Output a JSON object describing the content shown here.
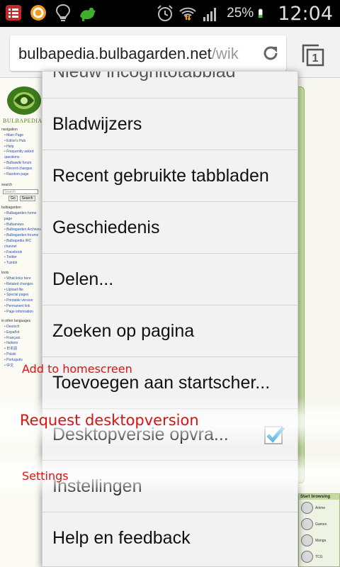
{
  "status_bar": {
    "battery_percent": "25%",
    "time": "12:04",
    "notification_icons": [
      "tasks-icon",
      "orange-ring-icon",
      "lightbulb-icon",
      "green-dino-icon"
    ],
    "system_icons": [
      "alarm-icon",
      "wifi-icon",
      "signal-icon",
      "battery-icon"
    ]
  },
  "toolbar": {
    "url_domain": "bulbapedia.bulbagarden.net",
    "url_path": "/wik",
    "reload_icon": "reload-icon",
    "tab_count": "1"
  },
  "page": {
    "logo_text": "BULBAPEDIA",
    "sections": {
      "navigation": {
        "title": "navigation",
        "items": [
          "Main Page",
          "Editor's Hub",
          "Help",
          "Frequently asked questions",
          "Bulbawiki forum",
          "Recent changes",
          "Random page"
        ]
      },
      "search": {
        "title": "search",
        "placeholder": "Search",
        "go_label": "Go",
        "search_label": "Search"
      },
      "bulbagarden": {
        "title": "bulbagarden",
        "items": [
          "Bulbagarden home page",
          "Bulbanews",
          "Bulbagarden Archives",
          "Bulbagarden forums",
          "Bulbapedia IRC channel",
          "Facebook",
          "Twitter",
          "Tumblr"
        ]
      },
      "tools": {
        "title": "tools",
        "items": [
          "What links here",
          "Related changes",
          "Upload file",
          "Special pages",
          "Printable version",
          "Permanent link",
          "Page information"
        ]
      },
      "languages": {
        "title": "in other languages",
        "items": [
          "Deutsch",
          "Español",
          "Français",
          "Italiano",
          "日本語",
          "Polski",
          "Português",
          "中文"
        ]
      }
    },
    "start_browsing": {
      "title": "Start browsing",
      "items": [
        "Anime",
        "Games",
        "Manga",
        "TCG"
      ]
    }
  },
  "menu": {
    "items": [
      {
        "label": "Nieuw incognitotabblad"
      },
      {
        "label": "Bladwijzers"
      },
      {
        "label": "Recent gebruikte tabbladen"
      },
      {
        "label": "Geschiedenis"
      },
      {
        "label": "Delen..."
      },
      {
        "label": "Zoeken op pagina"
      },
      {
        "label": "Toevoegen aan startscher..."
      },
      {
        "label": "Desktopversie opvra...",
        "checked": true
      },
      {
        "label": "Instellingen"
      },
      {
        "label": "Help en feedback"
      }
    ],
    "checkbox_color": "#33a3dc"
  },
  "overlay_labels": {
    "homescreen": "Add to homescreen",
    "desktop": "Request desktopversion",
    "settings": "Settings"
  }
}
